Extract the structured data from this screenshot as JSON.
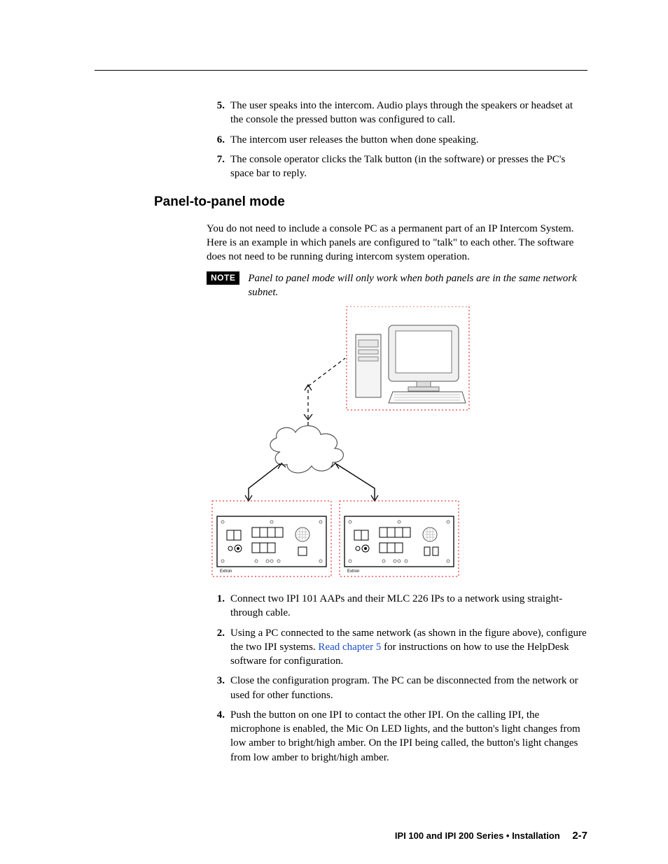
{
  "list1": [
    {
      "n": "5.",
      "t": "The user speaks into the intercom.  Audio plays through the speakers or headset at the console the pressed button was configured to call."
    },
    {
      "n": "6.",
      "t": "The intercom user releases the button when done speaking."
    },
    {
      "n": "7.",
      "t": "The console operator clicks the Talk button (in the software) or presses the PC's space bar to reply."
    }
  ],
  "section_heading": "Panel-to-panel mode",
  "intro_para": "You do not need to include a console PC as a permanent part of an IP Intercom System.  Here is an example in which panels are configured to \"talk\" to each other.  The software does not need to be running during intercom system operation.",
  "note_label": "NOTE",
  "note_text": "Panel to panel mode will only work when both panels are in the same network subnet.",
  "list2": [
    {
      "n": "1.",
      "pre": "Connect two IPI 101 AAPs and their MLC 226 IPs to a network using straight-through cable.",
      "link": "",
      "post": ""
    },
    {
      "n": "2.",
      "pre": "Using a PC connected to the same network (as shown in the figure above), configure the two IPI systems.  ",
      "link": "Read chapter 5",
      "post": " for instructions on how to use the HelpDesk software for configuration."
    },
    {
      "n": "3.",
      "pre": "Close the configuration program.  The PC can be disconnected from the network or used for other functions.",
      "link": "",
      "post": ""
    },
    {
      "n": "4.",
      "pre": "Push the button on one IPI to contact the other IPI.  On the calling IPI, the microphone is enabled, the Mic On LED lights, and the button's light changes from low amber to bright/high amber.  On the IPI being called, the button's light changes from low amber to bright/high amber.",
      "link": "",
      "post": ""
    }
  ],
  "footer_title": "IPI 100 and IPI 200 Series • Installation",
  "footer_page": "2-7",
  "diagram": {
    "pc_label": "",
    "panel_label_left": "Extron",
    "panel_label_right": "Extron"
  }
}
